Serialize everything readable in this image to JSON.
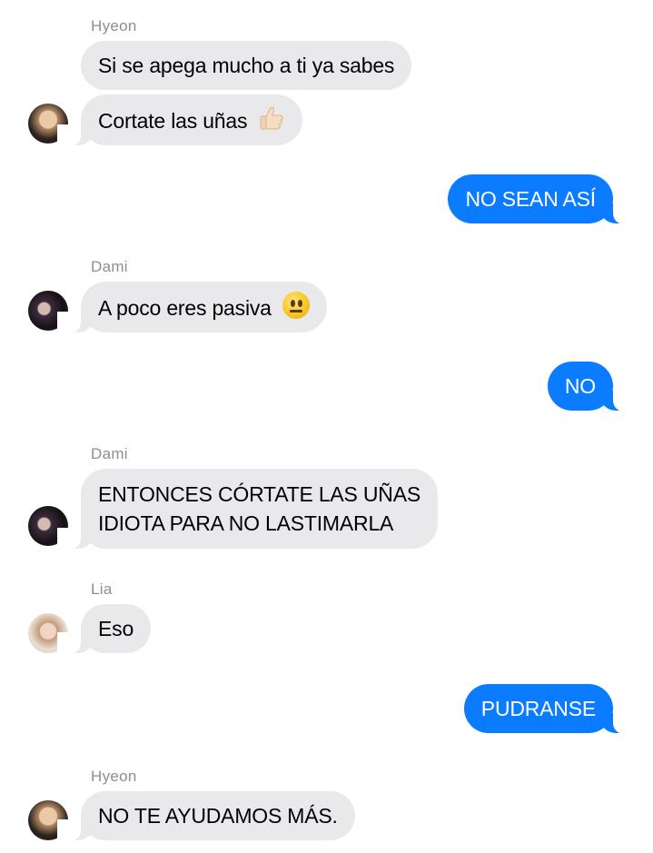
{
  "conversation": {
    "messages": [
      {
        "sender": "Hyeon",
        "text": "Si se apega mucho a ti ya sabes"
      },
      {
        "text": "Cortate las uñas",
        "emoji": "thumbs-up-icon"
      },
      {
        "direction": "outgoing",
        "text": "NO SEAN ASÍ"
      },
      {
        "sender": "Dami",
        "text": "A poco eres pasiva",
        "emoji": "neutral-face-icon"
      },
      {
        "direction": "outgoing",
        "text": "NO"
      },
      {
        "sender": "Dami",
        "text_line1": "ENTONCES CÓRTATE LAS UÑAS",
        "text_line2": "IDIOTA PARA NO LASTIMARLA"
      },
      {
        "sender": "Lia",
        "text": "Eso"
      },
      {
        "direction": "outgoing",
        "text": "PUDRANSE"
      },
      {
        "sender": "Hyeon",
        "text": "NO TE AYUDAMOS MÁS."
      }
    ]
  },
  "colors": {
    "incoming_bubble": "#e9e9eb",
    "outgoing_bubble": "#0b7cff",
    "sender_name": "#8e8e93"
  }
}
